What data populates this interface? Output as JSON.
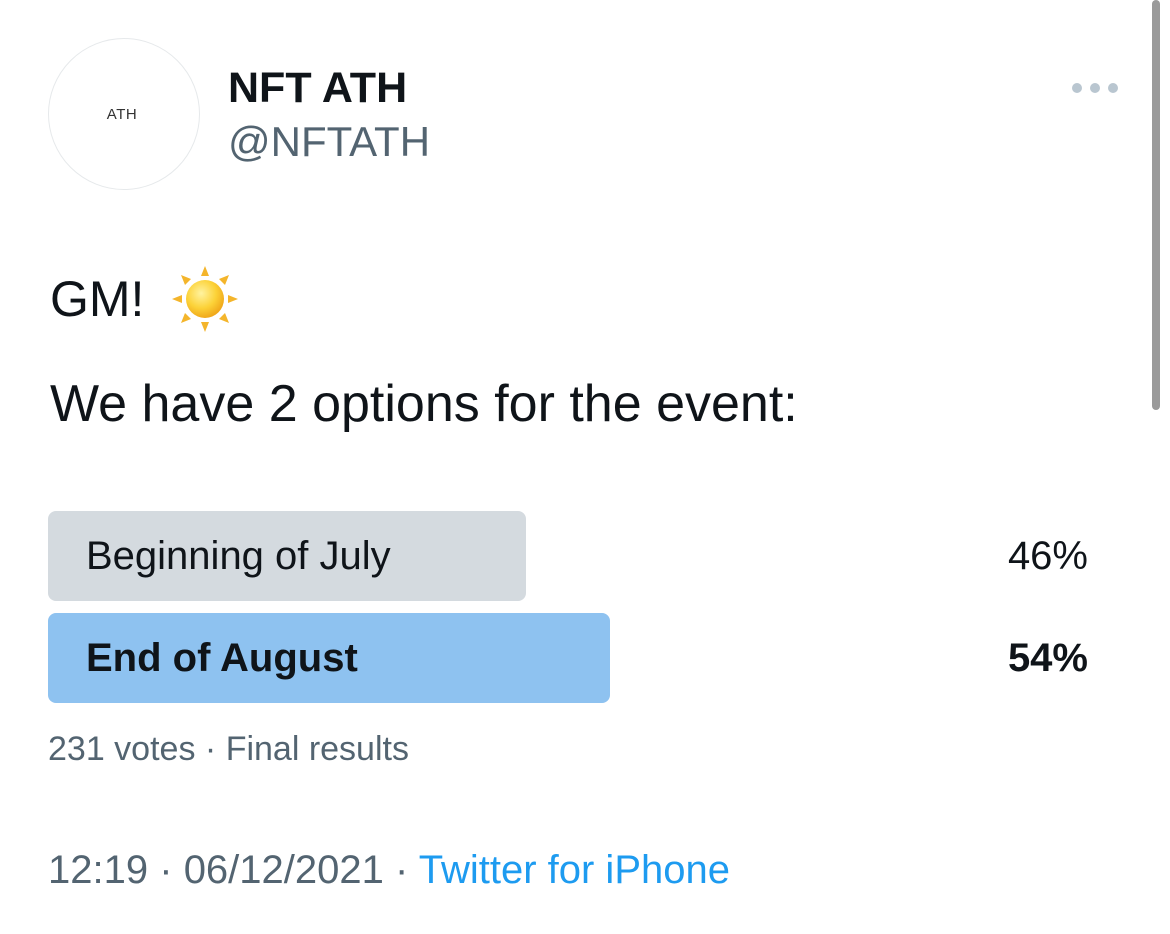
{
  "author": {
    "avatar_text": "ATH",
    "display_name": "NFT ATH",
    "handle": "@NFTATH"
  },
  "menu": {
    "more_icon": "more-horizontal-icon"
  },
  "tweet": {
    "line1": "GM!",
    "emoji_icon": "sun-icon",
    "line2": "We have 2 options for the event:"
  },
  "poll": {
    "options": [
      {
        "label": "Beginning of July",
        "percent_text": "46%",
        "percent": 46,
        "winner": false,
        "bar_color": "#d4dadf"
      },
      {
        "label": "End of August",
        "percent_text": "54%",
        "percent": 54,
        "winner": true,
        "bar_color": "#8ec2f0"
      }
    ],
    "votes": "231 votes",
    "separator": "·",
    "status": "Final results"
  },
  "meta": {
    "time": "12:19",
    "separator": "·",
    "date": "06/12/2021",
    "source": "Twitter for iPhone"
  },
  "colors": {
    "accent": "#1d9bf0",
    "secondary_text": "#536471"
  }
}
